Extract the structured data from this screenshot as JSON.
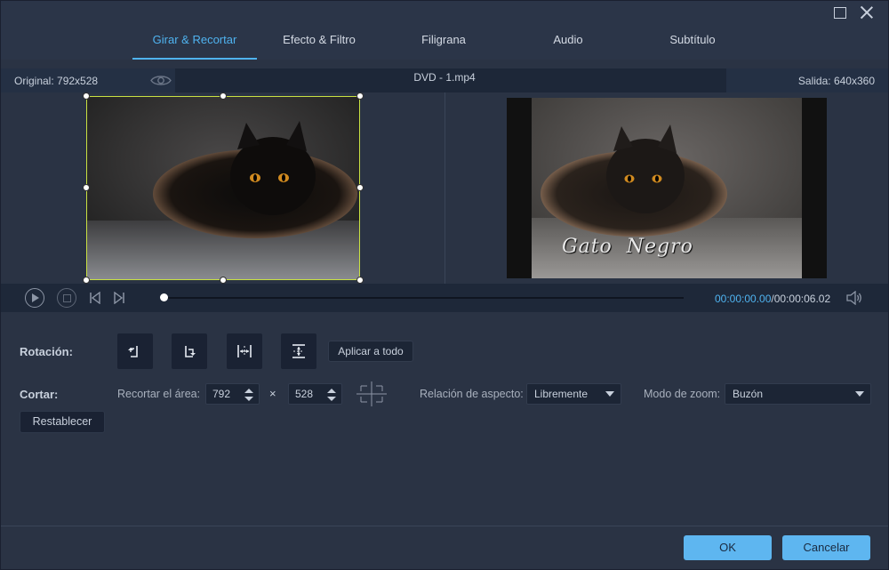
{
  "tabs": [
    {
      "label": "Girar & Recortar",
      "active": true
    },
    {
      "label": "Efecto & Filtro",
      "active": false
    },
    {
      "label": "Filigrana",
      "active": false
    },
    {
      "label": "Audio",
      "active": false
    },
    {
      "label": "Subtítulo",
      "active": false
    }
  ],
  "info": {
    "original": "Original: 792x528",
    "file": "DVD - 1.mp4",
    "output": "Salida: 640x360"
  },
  "preview": {
    "watermark_text": "Gato  Negro",
    "crop_color": "#c9e142"
  },
  "player": {
    "current_time": "00:00:00.00",
    "total_time": "/00:00:06.02",
    "progress": 0.0
  },
  "rotation": {
    "label": "Rotación:",
    "buttons": [
      "rotate-left-icon",
      "rotate-right-icon",
      "flip-horizontal-icon",
      "flip-vertical-icon"
    ],
    "apply_all": "Aplicar a todo"
  },
  "crop": {
    "label": "Cortar:",
    "area_label": "Recortar el área:",
    "width": "792",
    "times": "×",
    "height": "528",
    "aspect_label": "Relación de aspecto:",
    "aspect_value": "Libremente",
    "zoom_label": "Modo de zoom:",
    "zoom_value": "Buzón",
    "reset": "Restablecer"
  },
  "footer": {
    "ok": "OK",
    "cancel": "Cancelar"
  },
  "colors": {
    "accent": "#4fb3f0",
    "button": "#5eb6f0",
    "background": "#2a3344"
  }
}
